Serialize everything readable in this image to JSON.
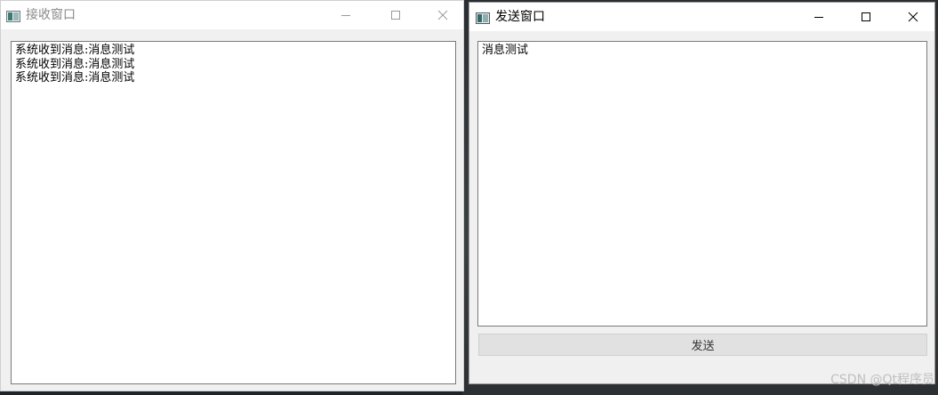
{
  "receiver": {
    "title": "接收窗口",
    "messages": [
      "系统收到消息:消息测试",
      "系统收到消息:消息测试",
      "系统收到消息:消息测试"
    ]
  },
  "sender": {
    "title": "发送窗口",
    "input_value": "消息测试",
    "send_label": "发送"
  },
  "watermark": "CSDN @Qt程序员",
  "colors": {
    "titlebar_bg": "#ffffff",
    "window_bg": "#f0f0f0",
    "inactive_title": "#8a8a8a",
    "active_title": "#000000",
    "button_bg": "#e1e1e1"
  },
  "icons": {
    "app": "qt-app-icon",
    "minimize": "minimize-icon",
    "maximize": "maximize-icon",
    "close": "close-icon"
  }
}
